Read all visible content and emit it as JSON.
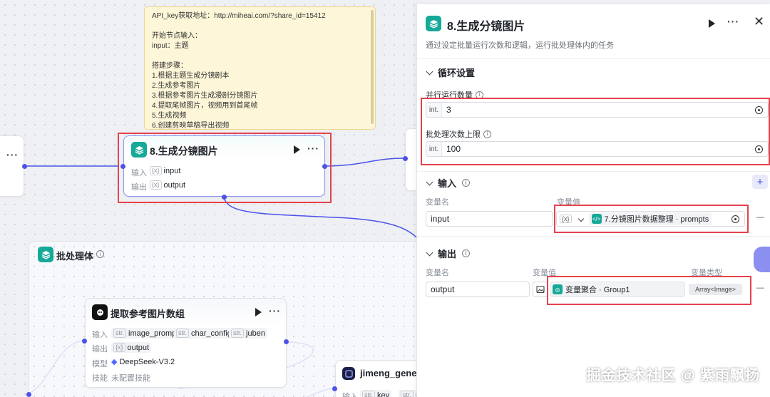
{
  "note": {
    "lines": [
      "API_key获取地址：http://miheai.com/?share_id=15412",
      "",
      "开始节点输入：",
      "input：主题",
      "",
      "搭建步骤：",
      "1.根据主题生成分镜剧本",
      "2.生成参考图片",
      "3.根据参考图片生成漫剧分镜图片",
      "4.提取尾帧图片，视频用到首尾帧",
      "5.生成视频",
      "6.创建剪映草稿导出视频"
    ]
  },
  "canvas": {
    "main_node": {
      "title": "8.生成分镜图片",
      "input_label": "输入",
      "output_label": "输出",
      "input_var": "input",
      "output_var": "output"
    },
    "batch_container": {
      "title": "批处理体"
    },
    "extract_node": {
      "title": "提取参考图片数组",
      "input_label": "输入",
      "output_label": "输出",
      "model_label": "模型",
      "skill_label": "技能",
      "inputs": [
        {
          "type": "str.",
          "name": "image_prompt"
        },
        {
          "type": "str.",
          "name": "char_config"
        },
        {
          "type": "str.",
          "name": "juben"
        }
      ],
      "output_type": "{x}",
      "output_var": "output",
      "model_value": "DeepSeek-V3.2",
      "skill_value": "未配置技能"
    },
    "jimeng_node": {
      "title": "jimeng_gener",
      "input_label": "输入",
      "inputs": [
        {
          "type": "str.",
          "name": "key"
        },
        {
          "type": "str.",
          "name": "prom"
        }
      ]
    }
  },
  "panel": {
    "title": "8.生成分镜图片",
    "description": "通过设定批量运行次数和逻辑，运行批处理体内的任务",
    "loop_section": {
      "title": "循环设置",
      "parallel_label": "并行运行数量",
      "parallel_prefix": "int.",
      "parallel_value": "3",
      "batch_label": "批处理次数上限",
      "batch_prefix": "int.",
      "batch_value": "100"
    },
    "input_section": {
      "title": "输入",
      "add_symbol": "+",
      "col_name": "变量名",
      "col_value": "变量值",
      "row": {
        "name": "input",
        "type_badge": "{x}",
        "ref_text": "7.分镜图片数据整理 · prompts"
      },
      "remove_symbol": "—"
    },
    "output_section": {
      "title": "输出",
      "col_name": "变量名",
      "col_value": "变量值",
      "col_type": "变量类型",
      "row": {
        "name": "output",
        "ref_text": "变量聚合 · Group1",
        "type": "Array<Image>"
      },
      "remove_symbol": "—"
    }
  },
  "watermark": "掘金技术社区 @ 紫雨飘扬",
  "colors": {
    "accent": "#4d53e8",
    "node_icon": "#16a898",
    "highlight_box": "#e5424d",
    "note_bg": "#fdf6d8"
  }
}
